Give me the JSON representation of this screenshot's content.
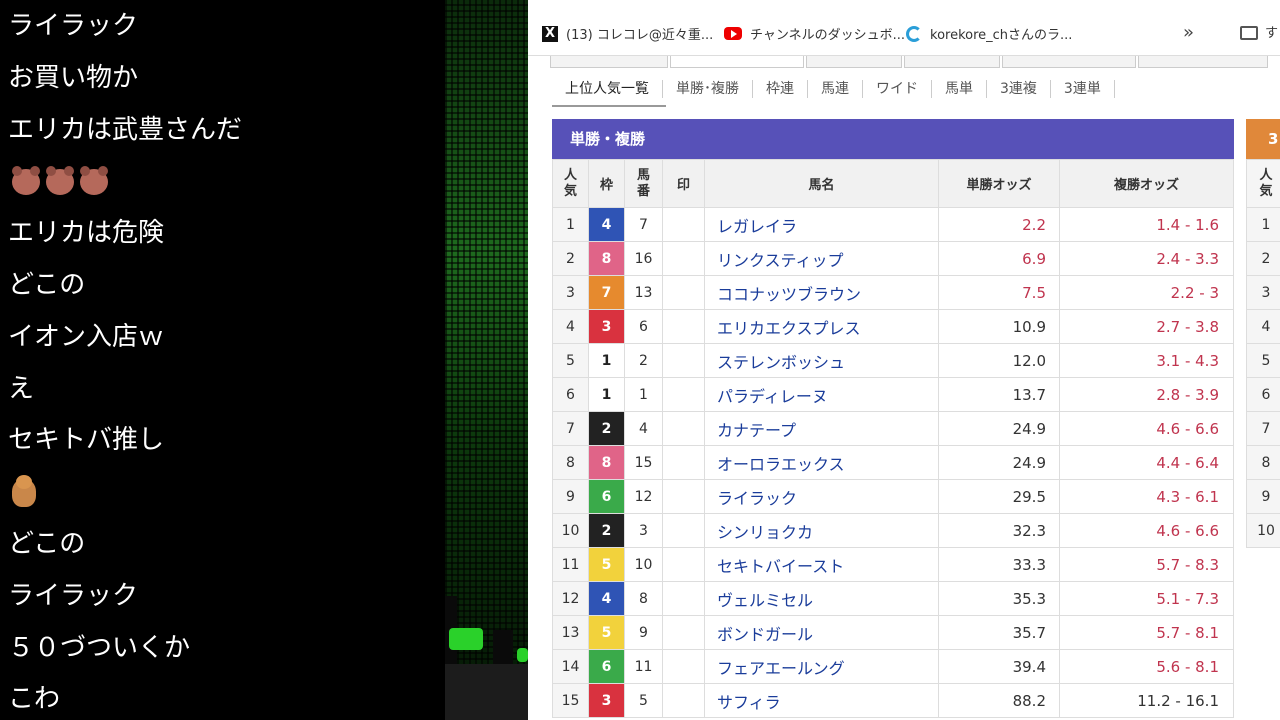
{
  "chat": {
    "lines": [
      {
        "text": "ライラック"
      },
      {
        "text": "お買い物か"
      },
      {
        "text": "エリカは武豊さんだ"
      },
      {
        "text": "",
        "emoji": "bear-face-icon"
      },
      {
        "text": "エリカは危険"
      },
      {
        "text": "どこの"
      },
      {
        "text": "イオン入店ｗ"
      },
      {
        "text": "え"
      },
      {
        "text": "セキトバ推し"
      },
      {
        "text": "",
        "emoji": "teddy-bear-icon"
      },
      {
        "text": "どこの"
      },
      {
        "text": "ライラック"
      },
      {
        "text": "５０づついくか"
      },
      {
        "text": "こわ"
      }
    ]
  },
  "bookmarks": [
    {
      "label": "(13) コレコレ@近々重...",
      "icon": "x-logo-icon"
    },
    {
      "label": "チャンネルのダッシュボ...",
      "icon": "youtube-icon"
    },
    {
      "label": "korekore_chさんのラ...",
      "icon": "ring-icon"
    }
  ],
  "bookmarks_more": "»",
  "bookmarks_folder_tail": "す",
  "subtabs": [
    "上位人気一覧",
    "単勝･複勝",
    "枠連",
    "馬連",
    "ワイド",
    "馬単",
    "3連複",
    "3連単"
  ],
  "section": {
    "title": "単勝・複勝",
    "right_title": "3"
  },
  "table": {
    "headers": {
      "rank": "人気",
      "waku": "枠",
      "num": "馬番",
      "mark": "印",
      "name": "馬名",
      "win": "単勝オッズ",
      "place": "複勝オッズ"
    },
    "colors": {
      "1": {
        "bg": "#ffffff",
        "fg": "#222222"
      },
      "2": {
        "bg": "#222222",
        "fg": "#ffffff"
      },
      "3": {
        "bg": "#d9323f",
        "fg": "#ffffff"
      },
      "4": {
        "bg": "#2f54b5",
        "fg": "#ffffff"
      },
      "5": {
        "bg": "#f2d23c",
        "fg": "#ffffff"
      },
      "6": {
        "bg": "#3aaa4a",
        "fg": "#ffffff"
      },
      "7": {
        "bg": "#e68a2e",
        "fg": "#ffffff"
      },
      "8": {
        "bg": "#e06488",
        "fg": "#ffffff"
      }
    },
    "win_colors": {
      "popular": "#c0344e",
      "normal": "#333333"
    },
    "rows": [
      {
        "rank": "1",
        "waku": "4",
        "num": "7",
        "name": "レガレイラ",
        "win": "2.2",
        "place": "1.4 - 1.6",
        "popular": true
      },
      {
        "rank": "2",
        "waku": "8",
        "num": "16",
        "name": "リンクスティップ",
        "win": "6.9",
        "place": "2.4 - 3.3",
        "popular": true
      },
      {
        "rank": "3",
        "waku": "7",
        "num": "13",
        "name": "ココナッツブラウン",
        "win": "7.5",
        "place": "2.2 - 3",
        "popular": true
      },
      {
        "rank": "4",
        "waku": "3",
        "num": "6",
        "name": "エリカエクスプレス",
        "win": "10.9",
        "place": "2.7 - 3.8",
        "popular": false
      },
      {
        "rank": "5",
        "waku": "1",
        "num": "2",
        "name": "ステレンボッシュ",
        "win": "12.0",
        "place": "3.1 - 4.3",
        "popular": false
      },
      {
        "rank": "6",
        "waku": "1",
        "num": "1",
        "name": "パラディレーヌ",
        "win": "13.7",
        "place": "2.8 - 3.9",
        "popular": false
      },
      {
        "rank": "7",
        "waku": "2",
        "num": "4",
        "name": "カナテープ",
        "win": "24.9",
        "place": "4.6 - 6.6",
        "popular": false
      },
      {
        "rank": "8",
        "waku": "8",
        "num": "15",
        "name": "オーロラエックス",
        "win": "24.9",
        "place": "4.4 - 6.4",
        "popular": false
      },
      {
        "rank": "9",
        "waku": "6",
        "num": "12",
        "name": "ライラック",
        "win": "29.5",
        "place": "4.3 - 6.1",
        "popular": false
      },
      {
        "rank": "10",
        "waku": "2",
        "num": "3",
        "name": "シンリョクカ",
        "win": "32.3",
        "place": "4.6 - 6.6",
        "popular": false
      },
      {
        "rank": "11",
        "waku": "5",
        "num": "10",
        "name": "セキトバイースト",
        "win": "33.3",
        "place": "5.7 - 8.3",
        "popular": false
      },
      {
        "rank": "12",
        "waku": "4",
        "num": "8",
        "name": "ヴェルミセル",
        "win": "35.3",
        "place": "5.1 - 7.3",
        "popular": false
      },
      {
        "rank": "13",
        "waku": "5",
        "num": "9",
        "name": "ボンドガール",
        "win": "35.7",
        "place": "5.7 - 8.1",
        "popular": false
      },
      {
        "rank": "14",
        "waku": "6",
        "num": "11",
        "name": "フェアエールング",
        "win": "39.4",
        "place": "5.6 - 8.1",
        "popular": false
      },
      {
        "rank": "15",
        "waku": "3",
        "num": "5",
        "name": "サフィラ",
        "win": "88.2",
        "place": "11.2 - 16.1",
        "popular": false,
        "place_plain": true
      }
    ]
  },
  "right_table": {
    "header": "人気",
    "ranks": [
      "1",
      "2",
      "3",
      "4",
      "5",
      "6",
      "7",
      "8",
      "9",
      "10"
    ]
  }
}
